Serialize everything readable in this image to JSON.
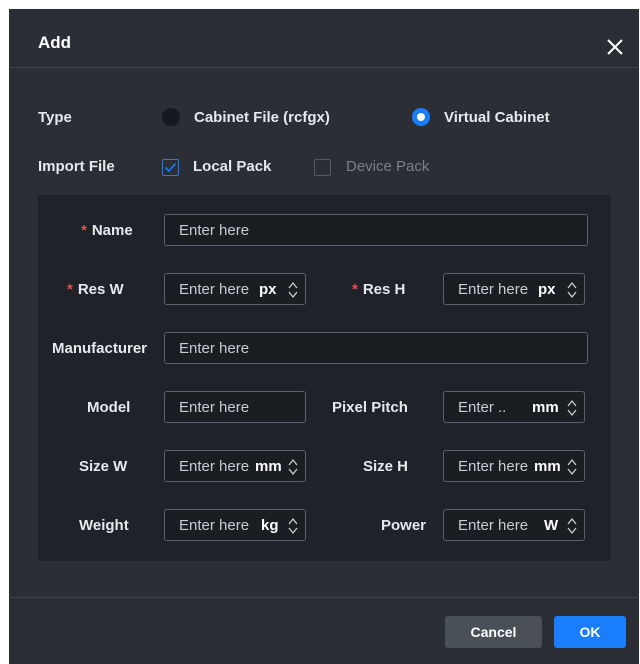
{
  "dialog": {
    "title": "Add",
    "close_icon": "close-icon"
  },
  "type_row": {
    "label": "Type",
    "options": [
      {
        "label": "Cabinet File (rcfgx)",
        "selected": false
      },
      {
        "label": "Virtual Cabinet",
        "selected": true
      }
    ]
  },
  "import_row": {
    "label": "Import File",
    "options": [
      {
        "label": "Local Pack",
        "checked": true,
        "disabled": false
      },
      {
        "label": "Device Pack",
        "checked": false,
        "disabled": true
      }
    ]
  },
  "form": {
    "required_mark": "*",
    "name": {
      "label": "Name",
      "placeholder": "Enter here"
    },
    "res_w": {
      "label": "Res W",
      "placeholder": "Enter here",
      "unit": "px"
    },
    "res_h": {
      "label": "Res H",
      "placeholder": "Enter here",
      "unit": "px"
    },
    "manufacturer": {
      "label": "Manufacturer",
      "placeholder": "Enter here"
    },
    "model": {
      "label": "Model",
      "placeholder": "Enter here"
    },
    "pixel_pitch": {
      "label": "Pixel Pitch",
      "placeholder": "Enter ..",
      "unit": "mm"
    },
    "size_w": {
      "label": "Size W",
      "placeholder": "Enter here",
      "unit": "mm"
    },
    "size_h": {
      "label": "Size H",
      "placeholder": "Enter here",
      "unit": "mm"
    },
    "weight": {
      "label": "Weight",
      "placeholder": "Enter here",
      "unit": "kg"
    },
    "power": {
      "label": "Power",
      "placeholder": "Enter here",
      "unit": "W"
    }
  },
  "footer": {
    "cancel_label": "Cancel",
    "ok_label": "OK"
  },
  "colors": {
    "accent": "#1a7dfb",
    "required": "#f04a4a",
    "dialog_bg": "#2b2f35",
    "panel_bg": "#1f2329"
  }
}
